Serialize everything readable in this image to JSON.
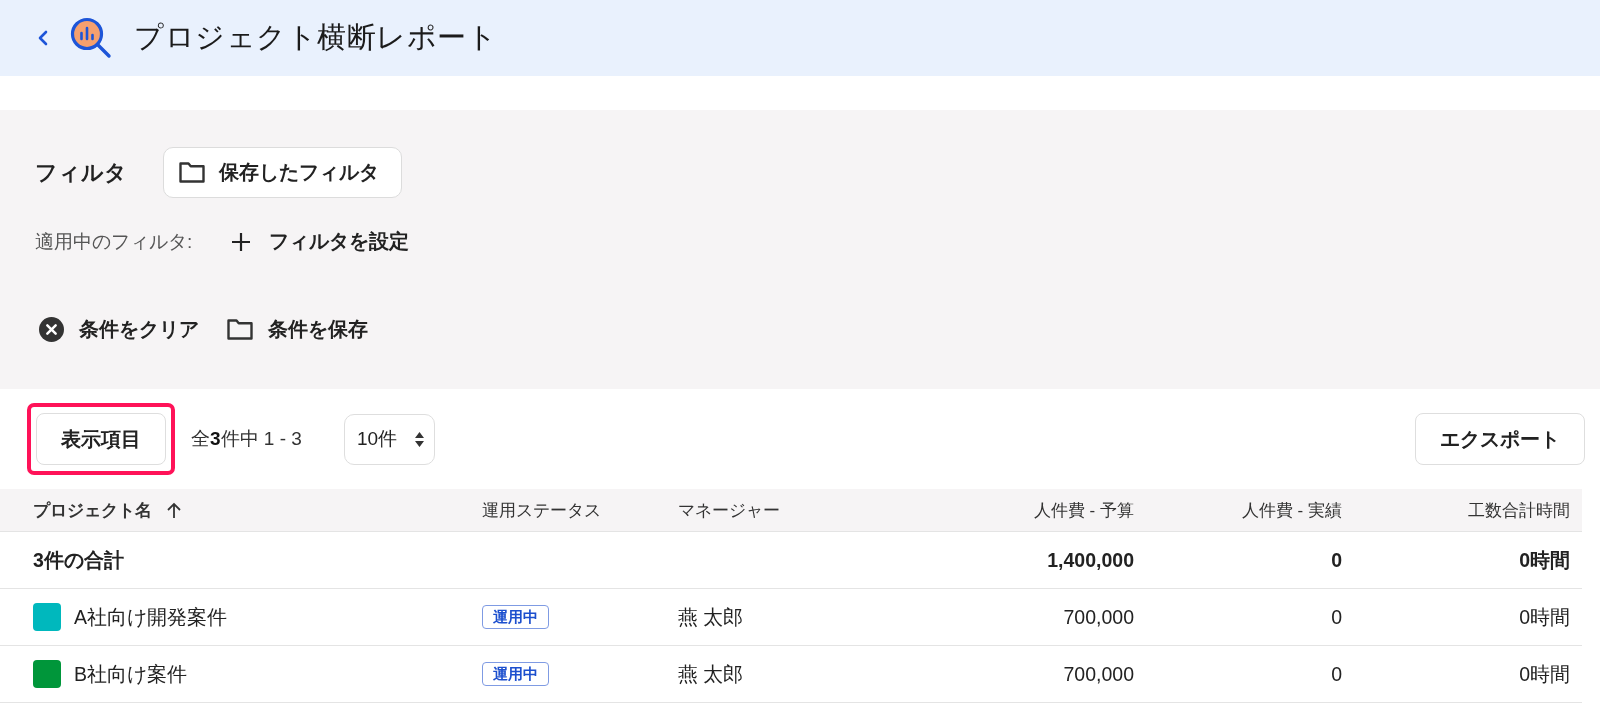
{
  "header": {
    "title": "プロジェクト横断レポート"
  },
  "filter_panel": {
    "heading": "フィルタ",
    "saved_filters_button": "保存したフィルタ",
    "applied_label": "適用中のフィルタ:",
    "add_filter_button": "フィルタを設定",
    "actions": [
      {
        "kind": "clear",
        "label": "条件をクリア"
      },
      {
        "kind": "save",
        "label": "条件を保存"
      }
    ]
  },
  "toolbar": {
    "columns_button": {
      "label": "表示項目",
      "highlighted": true
    },
    "count": "全**3**件中 1 - 3",
    "page_size": "10件",
    "export_button": "エクスポート"
  },
  "table": {
    "columns": [
      {
        "label": "プロジェクト名",
        "kind": "name",
        "sorted": true
      },
      {
        "label": "運用ステータス",
        "kind": "status",
        "sorted": false
      },
      {
        "label": "マネージャー",
        "kind": "person",
        "sorted": false
      },
      {
        "label": "人件費 - 予算",
        "kind": "number",
        "sorted": false
      },
      {
        "label": "人件費 - 実績",
        "kind": "number",
        "sorted": false
      },
      {
        "label": "工数合計時間",
        "kind": "number",
        "sorted": false
      }
    ],
    "total": {
      "label": "3件の合計",
      "values": [
        "1,400,000",
        "0",
        "0時間"
      ]
    },
    "rows": [
      {
        "color": "#00b8bd",
        "cells": [
          "A社向け開発案件",
          "運用中",
          "燕 太郎",
          "700,000",
          "0",
          "0時間"
        ]
      },
      {
        "color": "#00963a",
        "cells": [
          "B社向け案件",
          "運用中",
          "燕 太郎",
          "700,000",
          "0",
          "0時間"
        ]
      }
    ]
  }
}
